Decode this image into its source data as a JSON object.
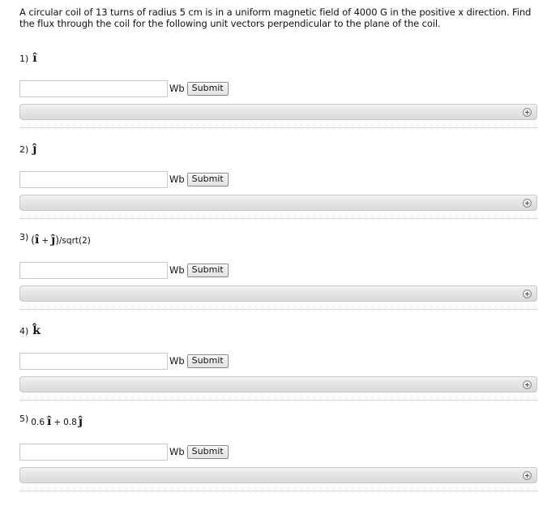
{
  "problem": {
    "text": "A circular coil of 13 turns of radius 5 cm is in a uniform magnetic field of 4000 G in the positive x direction. Find the flux through the coil for the following unit vectors perpendicular to the plane of the coil."
  },
  "parts": [
    {
      "number": "1)",
      "vector": "î"
    },
    {
      "number": "2)",
      "vector": "ĵ"
    },
    {
      "number": "3)",
      "open": "(",
      "v1": "î",
      "plus": "+",
      "v2": "ĵ",
      "close": ")",
      "suffix": "/sqrt(2)"
    },
    {
      "number": "4)",
      "vector": "k̂"
    },
    {
      "number": "5)",
      "c1": "0.6",
      "v1": "î",
      "plus": "+",
      "c2": "0.8",
      "v2": "ĵ"
    }
  ],
  "answer": {
    "value": "",
    "unit": "Wb",
    "submit_label": "Submit"
  },
  "icons": {
    "expand": "plus-circle-icon"
  }
}
